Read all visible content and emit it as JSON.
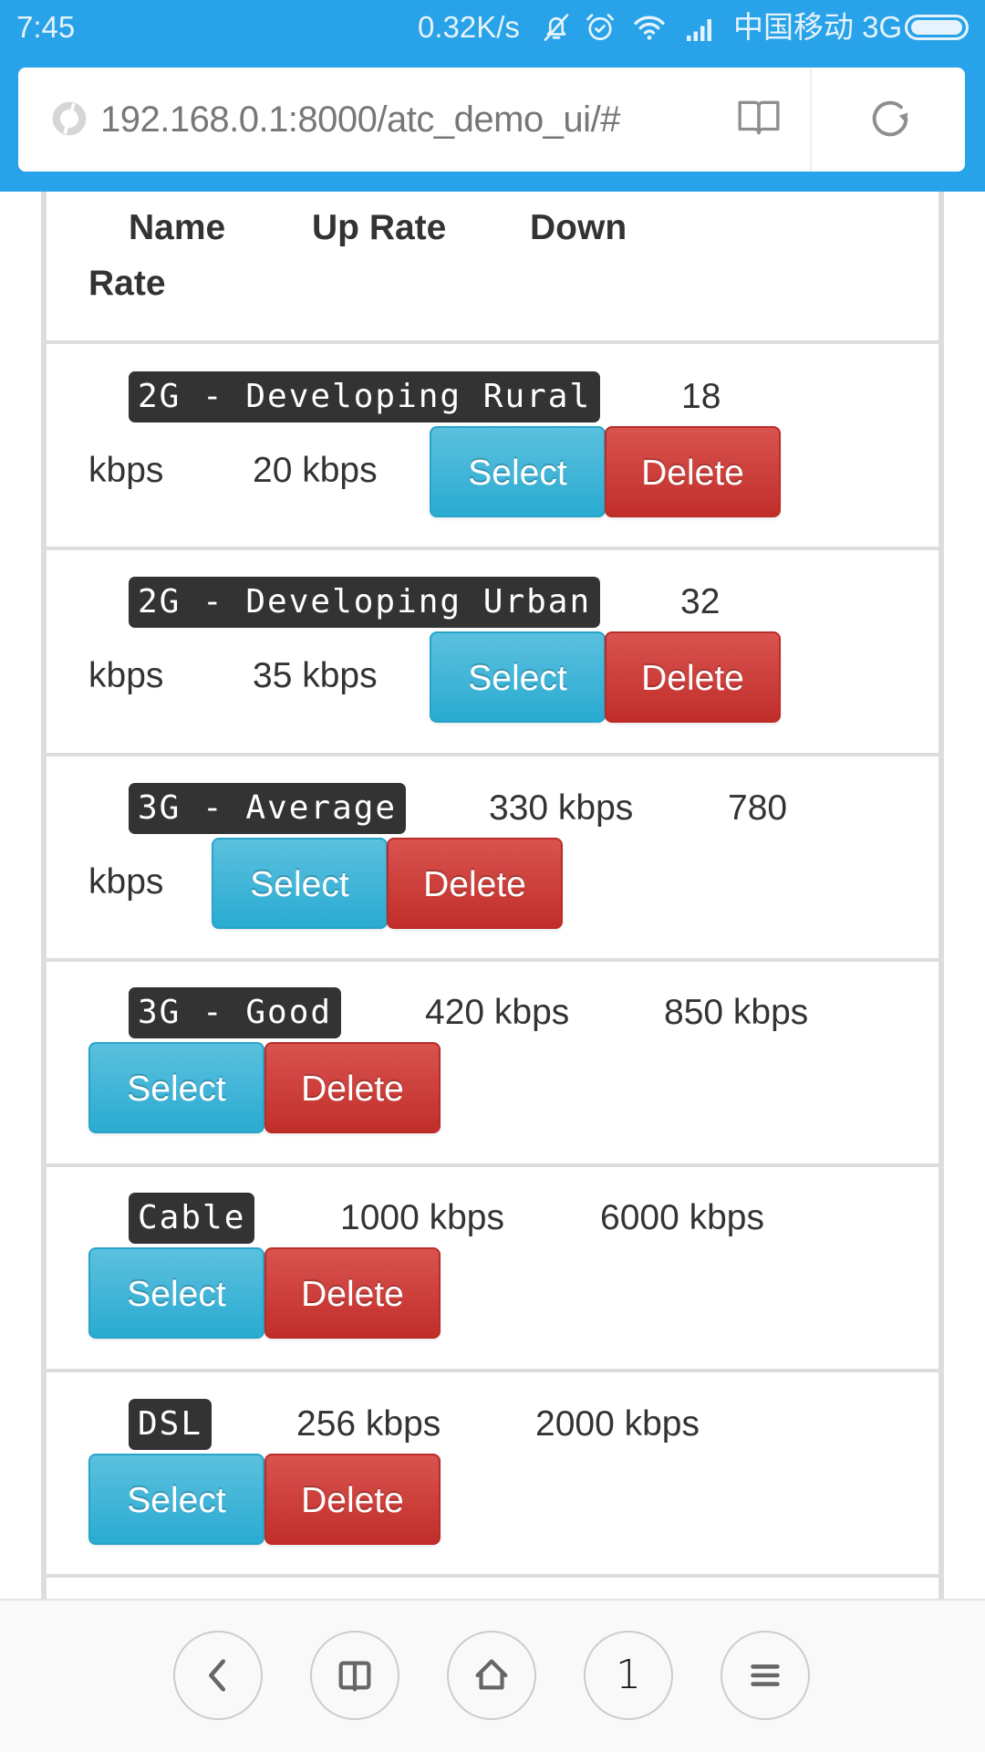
{
  "status_bar": {
    "time": "7:45",
    "network_speed": "0.32K/s",
    "carrier": "中国移动 3G",
    "icons": [
      "bell-off-icon",
      "alarm-icon",
      "wifi-icon",
      "signal-icon",
      "battery-icon"
    ]
  },
  "browser": {
    "url": "192.168.0.1:8000/atc_demo_ui/#",
    "reader_icon": "book-icon",
    "reload_icon": "reload-icon"
  },
  "table": {
    "headers": [
      "Name",
      "Up Rate",
      "Down",
      "Rate"
    ],
    "rows": [
      {
        "name": "2G - Developing Rural",
        "up_rate": "18 kbps",
        "up_part1": "18",
        "up_part2": "kbps",
        "down_rate": "20 kbps",
        "select": "Select",
        "delete": "Delete"
      },
      {
        "name": "2G - Developing Urban",
        "up_rate": "32 kbps",
        "up_part1": "32",
        "up_part2": "kbps",
        "down_rate": "35 kbps",
        "select": "Select",
        "delete": "Delete"
      },
      {
        "name": "3G - Average",
        "up_rate": "330 kbps",
        "down_rate": "780 kbps",
        "down_part1": "780",
        "down_part2": "kbps",
        "select": "Select",
        "delete": "Delete"
      },
      {
        "name": "3G - Good",
        "up_rate": "420 kbps",
        "down_rate": "850 kbps",
        "select": "Select",
        "delete": "Delete"
      },
      {
        "name": "Cable",
        "up_rate": "1000 kbps",
        "down_rate": "6000 kbps",
        "select": "Select",
        "delete": "Delete"
      },
      {
        "name": "DSL",
        "up_rate": "256 kbps",
        "down_rate": "2000 kbps",
        "select": "Select",
        "delete": "Delete"
      }
    ]
  },
  "bottom_nav": {
    "items": [
      "back-icon",
      "bookmarks-icon",
      "home-icon",
      "tabs-count",
      "menu-icon"
    ],
    "tabs_count": "1"
  },
  "colors": {
    "header_blue": "#28a2e8",
    "select_button": "#31b0d5",
    "delete_button": "#c9302c",
    "label_bg": "#333333",
    "border_gray": "#dddddd"
  }
}
